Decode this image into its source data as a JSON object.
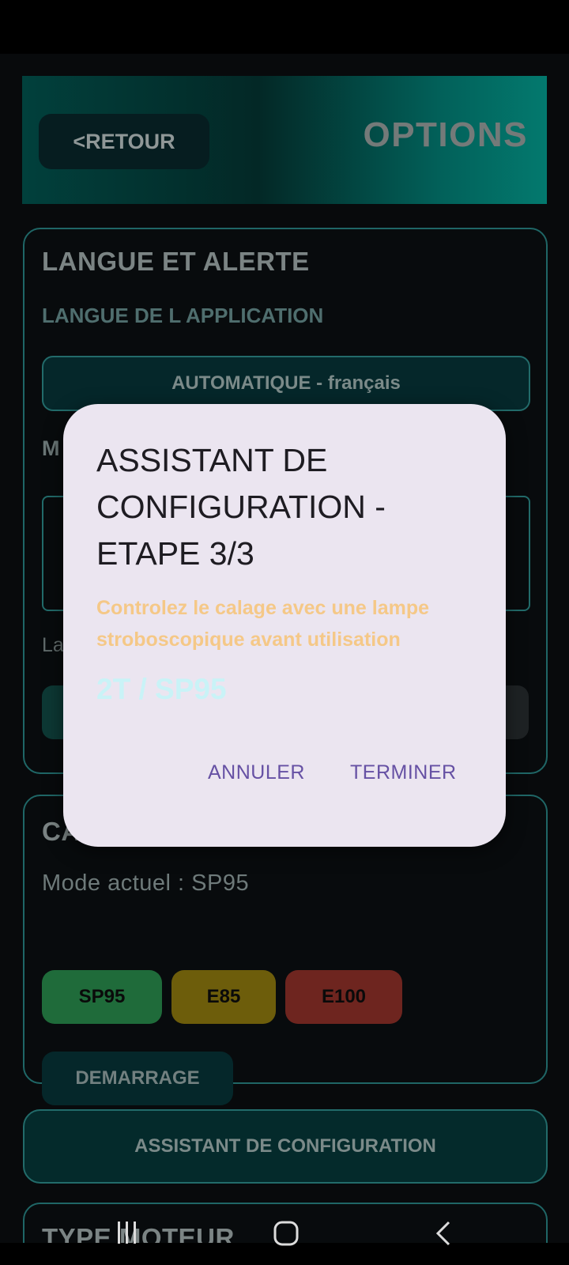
{
  "header": {
    "back_label": "<RETOUR",
    "title": "OPTIONS"
  },
  "language_section": {
    "title": "LANGUE ET ALERTE",
    "app_language_label": "LANGUE DE L APPLICATION",
    "language_button": "AUTOMATIQUE - français",
    "partial_label": "M",
    "partial_text": "La"
  },
  "fuel_section": {
    "title_partial": "CA",
    "current_mode": "Mode actuel : SP95",
    "buttons": [
      {
        "label": "SP95",
        "color": "#1f6b3a"
      },
      {
        "label": "E85",
        "color": "#6d5d0b"
      },
      {
        "label": "E100",
        "color": "#6e251f"
      }
    ],
    "demarrage_label": "DEMARRAGE"
  },
  "assistant_button": "ASSISTANT DE CONFIGURATION",
  "engine_section": {
    "title": "TYPE MOTEUR"
  },
  "dialog": {
    "title": "ASSISTANT DE CONFIGURATION - ETAPE 3/3",
    "warning": "Controlez le calage avec une lampe stroboscopique avant utilisation",
    "mode": "2T / SP95",
    "cancel": "ANNULER",
    "confirm": "TERMINER"
  },
  "navbar": {
    "recents_icon": "recents-icon",
    "home_icon": "home-icon",
    "back_icon": "back-icon"
  }
}
